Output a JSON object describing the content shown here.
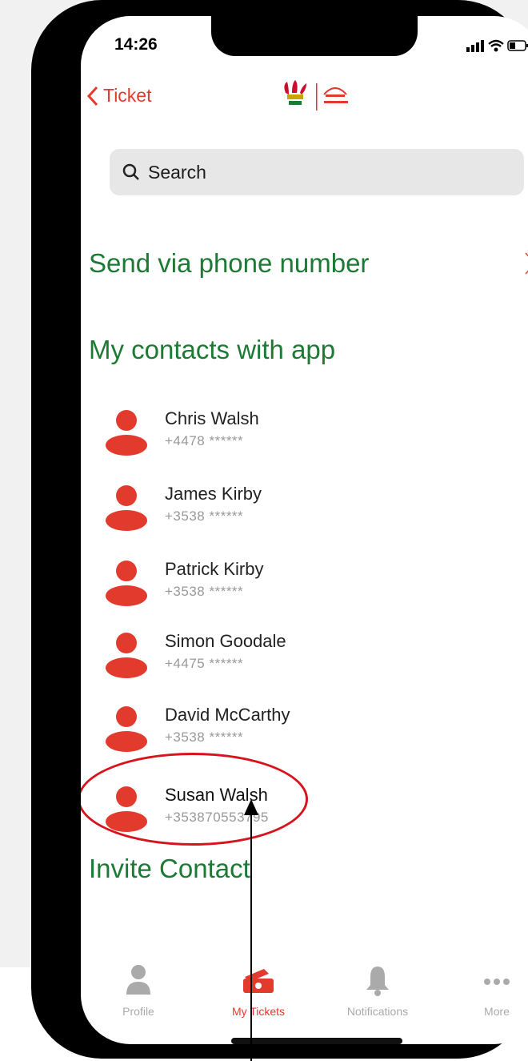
{
  "status_bar": {
    "time": "14:26"
  },
  "nav": {
    "back_label": "Ticket"
  },
  "search": {
    "placeholder": "Search"
  },
  "send_option": {
    "label": "Send via phone number"
  },
  "contacts_section": {
    "title": "My contacts with app"
  },
  "contacts": [
    {
      "name": "Chris Walsh",
      "phone": "+4478 ******"
    },
    {
      "name": "James Kirby",
      "phone": "+3538 ******"
    },
    {
      "name": "Patrick Kirby",
      "phone": "+3538 ******"
    },
    {
      "name": "Simon Goodale",
      "phone": "+4475 ******"
    },
    {
      "name": "David McCarthy",
      "phone": "+3538 ******"
    },
    {
      "name": "Susan Walsh",
      "phone": "+353870553795"
    }
  ],
  "invite": {
    "label": "Invite Contact"
  },
  "tabbar": {
    "tabs": [
      {
        "label": "Profile",
        "icon": "person-icon",
        "active": false
      },
      {
        "label": "My Tickets",
        "icon": "ticket-icon",
        "active": true
      },
      {
        "label": "Notifications",
        "icon": "bell-icon",
        "active": false
      },
      {
        "label": "More",
        "icon": "more-dots-icon",
        "active": false
      }
    ]
  },
  "colors": {
    "accent_red": "#e23b2e",
    "title_green": "#1d7a34",
    "annotation_red": "#d7141e"
  }
}
